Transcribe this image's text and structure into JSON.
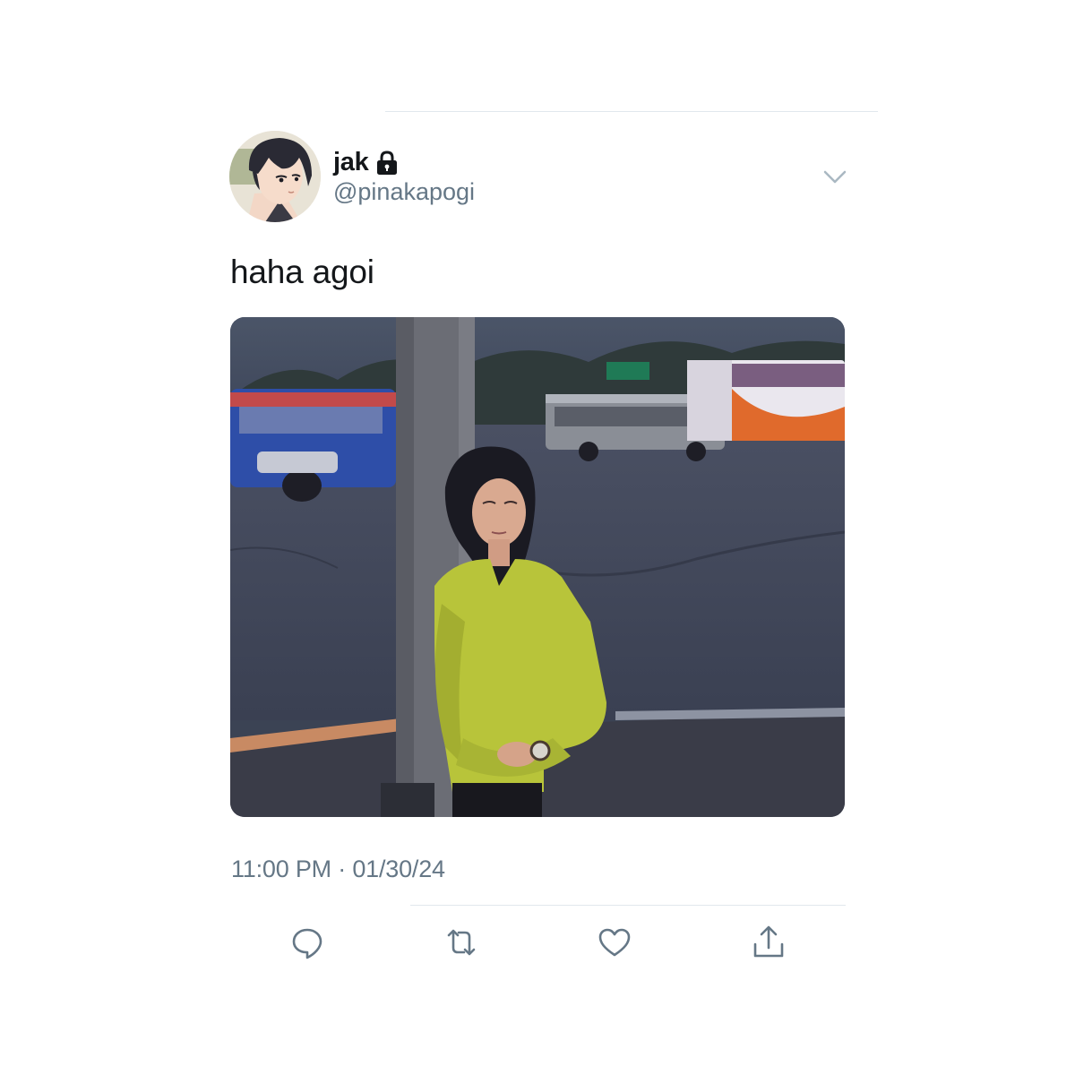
{
  "tweet": {
    "display_name": "jak",
    "handle": "@pinakapogi",
    "text": "haha agoi",
    "timestamp": "11:00 PM · 01/30/24"
  },
  "icons": {
    "verified_lock": "lock-icon",
    "menu": "chevron-down-icon",
    "reply": "reply-icon",
    "retweet": "retweet-icon",
    "like": "heart-icon",
    "share": "share-icon"
  },
  "colors": {
    "text_primary": "#14171a",
    "text_secondary": "#657786",
    "divider": "#e1e8ed"
  }
}
